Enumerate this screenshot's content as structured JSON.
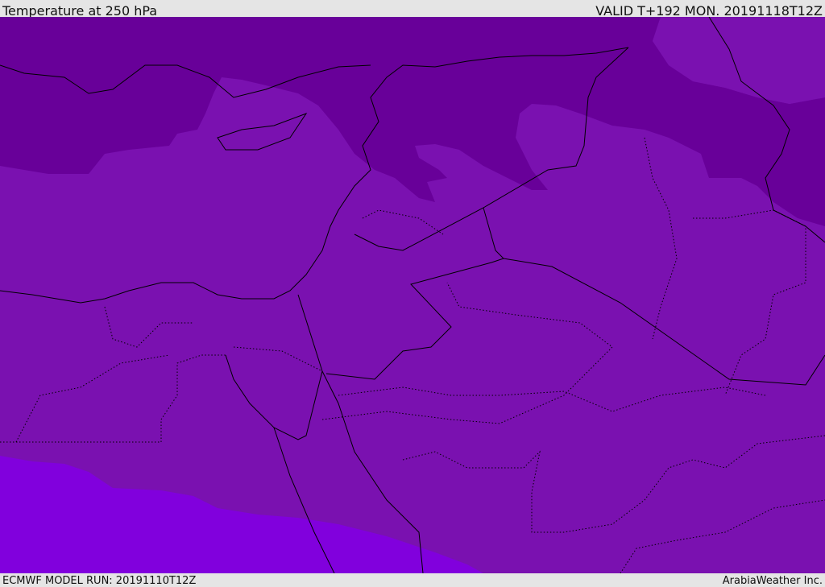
{
  "header": {
    "title": "Temperature at 250 hPa",
    "valid": "VALID T+192 MON. 20191118T12Z"
  },
  "footer": {
    "model_run": "ECMWF MODEL RUN: 20191110T12Z",
    "credit": "ArabiaWeather Inc."
  },
  "colors": {
    "cold": "#680099",
    "mid": "#7a11b0",
    "warm": "#8100dd",
    "background": "#e5e5e5"
  }
}
